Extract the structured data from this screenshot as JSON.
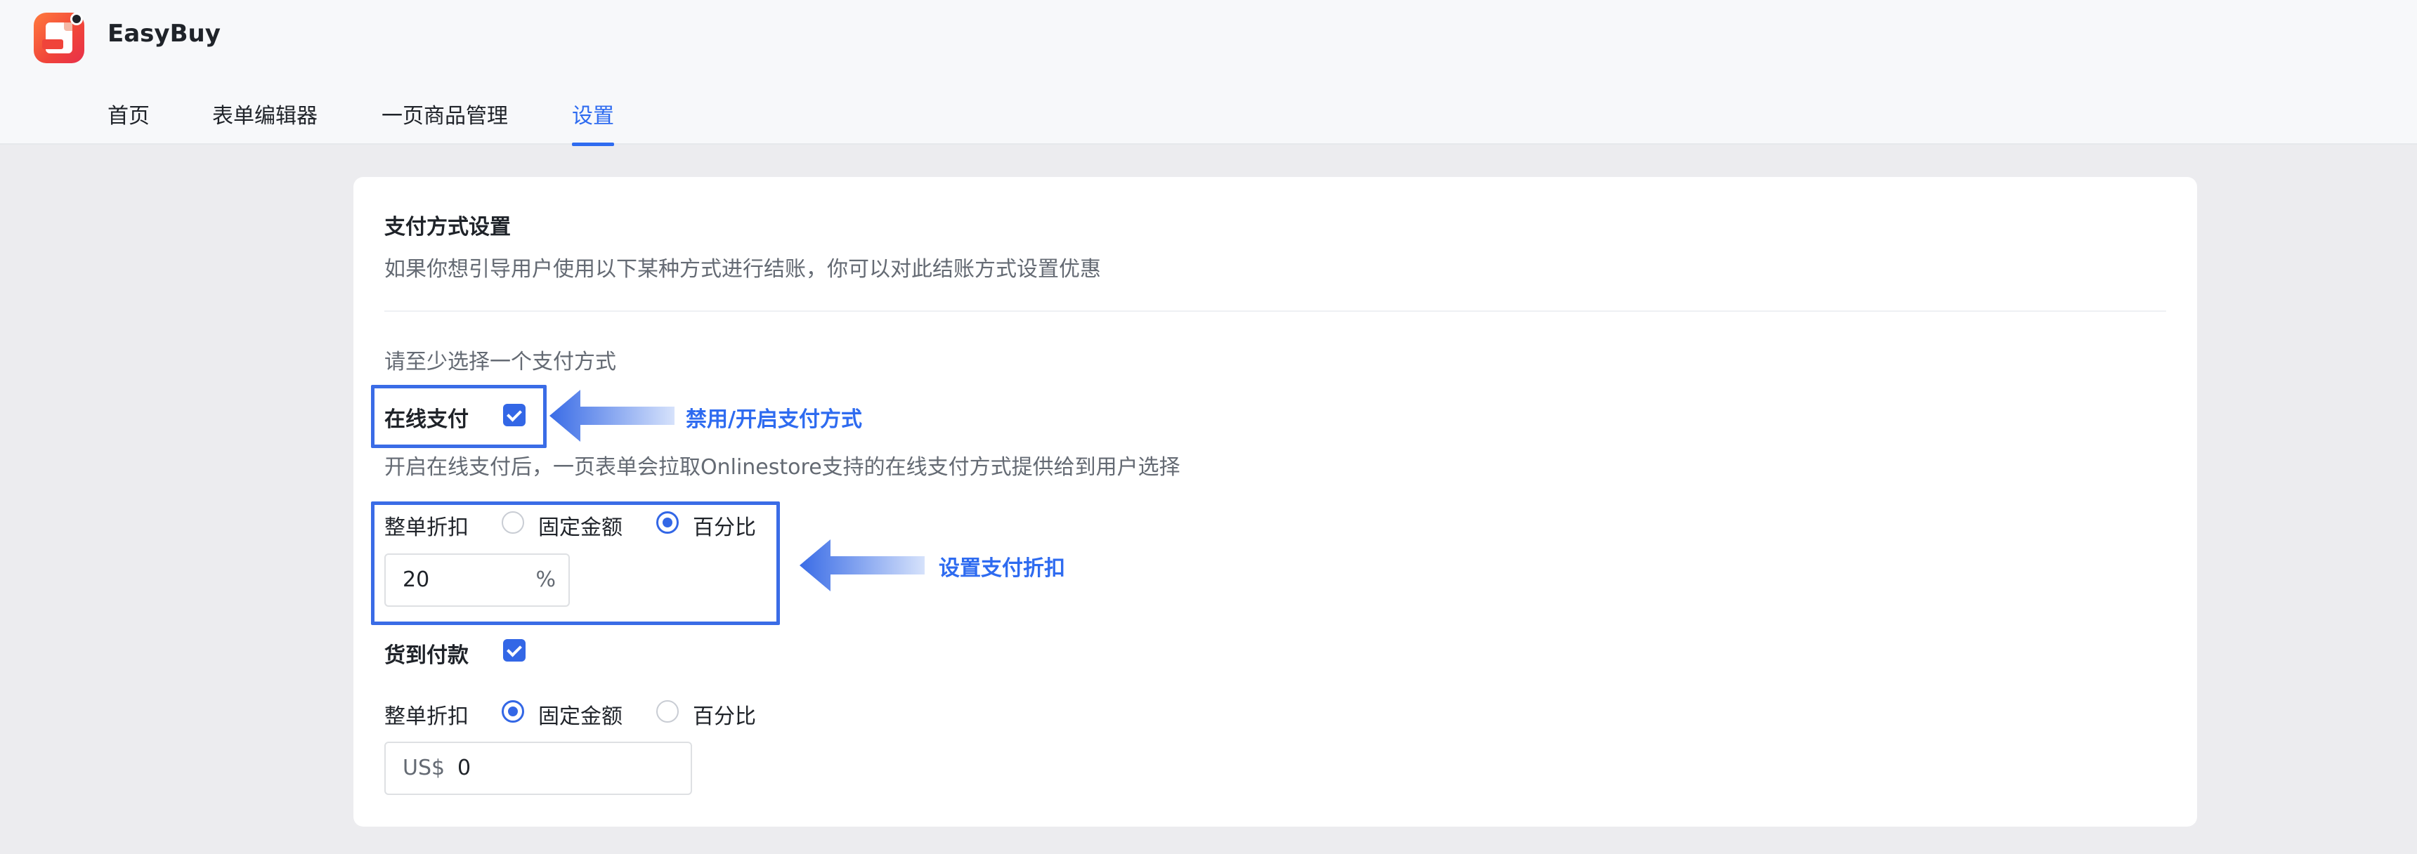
{
  "app": {
    "title": "EasyBuy",
    "logo_icon": "doc-logo-icon",
    "brand_color": "#f0443a"
  },
  "nav": {
    "items": [
      {
        "label": "首页"
      },
      {
        "label": "表单编辑器"
      },
      {
        "label": "一页商品管理"
      },
      {
        "label": "设置"
      }
    ],
    "active_index": 3,
    "active_color": "#2e6bf0"
  },
  "payment": {
    "title": "支付方式设置",
    "description": "如果你想引导用户使用以下某种方式进行结账，你可以对此结账方式设置优惠",
    "hint": "请至少选择一个支付方式",
    "online": {
      "label": "在线支付",
      "enabled": true,
      "note": "开启在线支付后，一页表单会拉取Onlinestore支持的在线支付方式提供给到用户选择",
      "discount_label": "整单折扣",
      "options": [
        "固定金额",
        "百分比"
      ],
      "selected": "百分比",
      "value": "20",
      "unit": "%"
    },
    "cod": {
      "label": "货到付款",
      "enabled": true,
      "discount_label": "整单折扣",
      "options": [
        "固定金额",
        "百分比"
      ],
      "selected": "固定金额",
      "currency": "US$",
      "value": "0"
    }
  },
  "annotations": {
    "toggle_note": "禁用/开启支付方式",
    "discount_note": "设置支付折扣",
    "color": "#3a6ce6"
  }
}
